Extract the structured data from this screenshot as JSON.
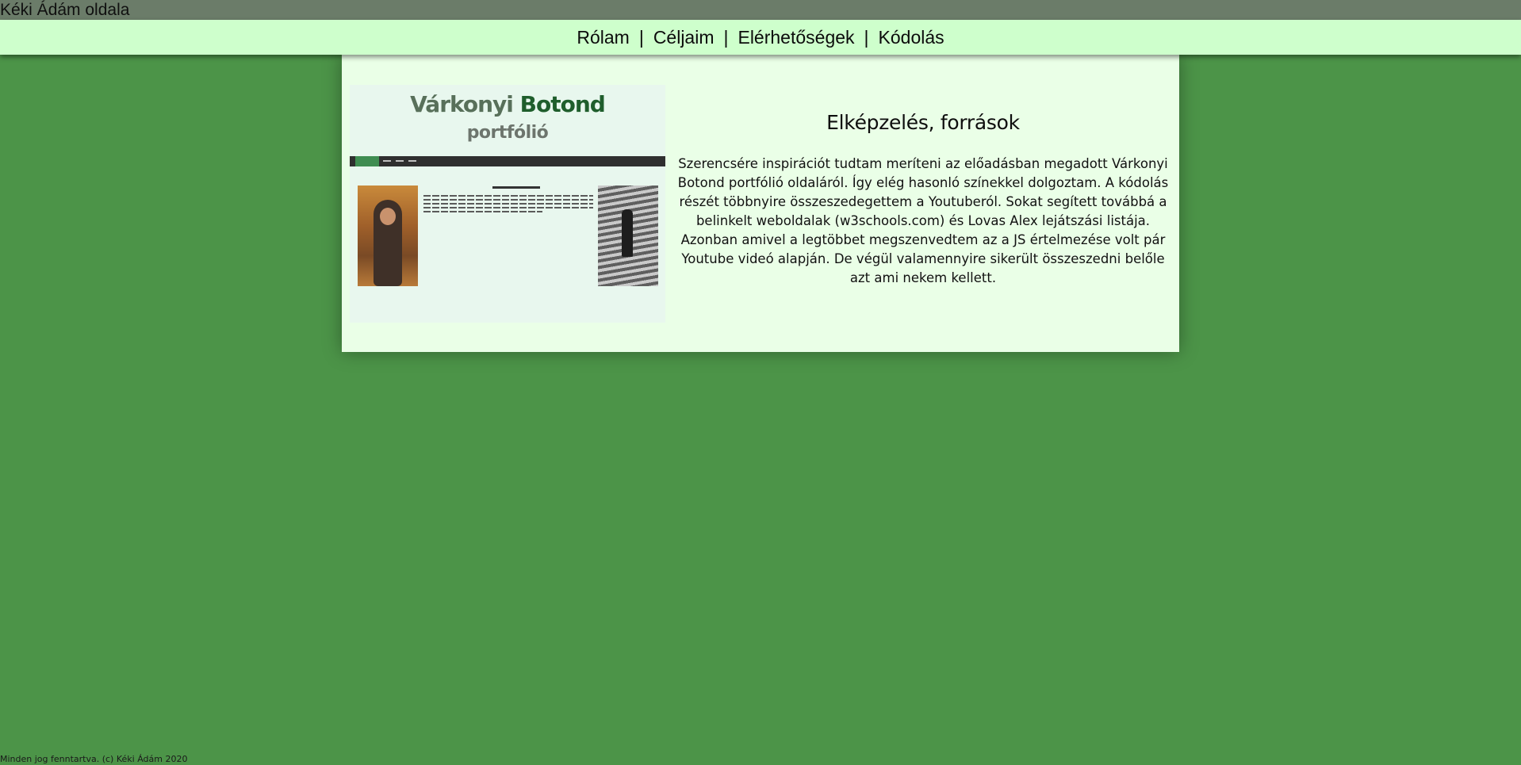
{
  "site_title": "Kéki Ádám oldala",
  "nav": {
    "items": [
      {
        "label": "Rólam"
      },
      {
        "label": "Céljaim"
      },
      {
        "label": "Elérhetőségek"
      },
      {
        "label": "Kódolás"
      }
    ],
    "separator": "|"
  },
  "main": {
    "screenshot": {
      "title_part1": "Várkonyi",
      "title_part2": "Botond",
      "subtitle": "portfólió"
    },
    "heading": "Elképzelés, források",
    "paragraph": "Szerencsére inspirációt tudtam meríteni az előadásban megadott Várkonyi Botond portfólió oldaláról. Így elég hasonló színekkel dolgoztam. A kódolás részét többnyire összeszedegettem a Youtuberól. Sokat segített továbbá a belinkelt weboldalak (w3schools.com) és Lovas Alex lejátszási listája. Azonban amivel a legtöbbet megszenvedtem az a JS értelmezése volt pár Youtube videó alapján. De végül valamennyire sikerült összeszedni belőle azt ami nekem kellett."
  },
  "footer": {
    "text": "Minden jog fenntartva. (c) Kéki Ádám 2020"
  },
  "colors": {
    "page_background": "#4c9448",
    "topbar": "#6b7c69",
    "navbar": "#ceffcc",
    "card": "#eaffe7"
  }
}
